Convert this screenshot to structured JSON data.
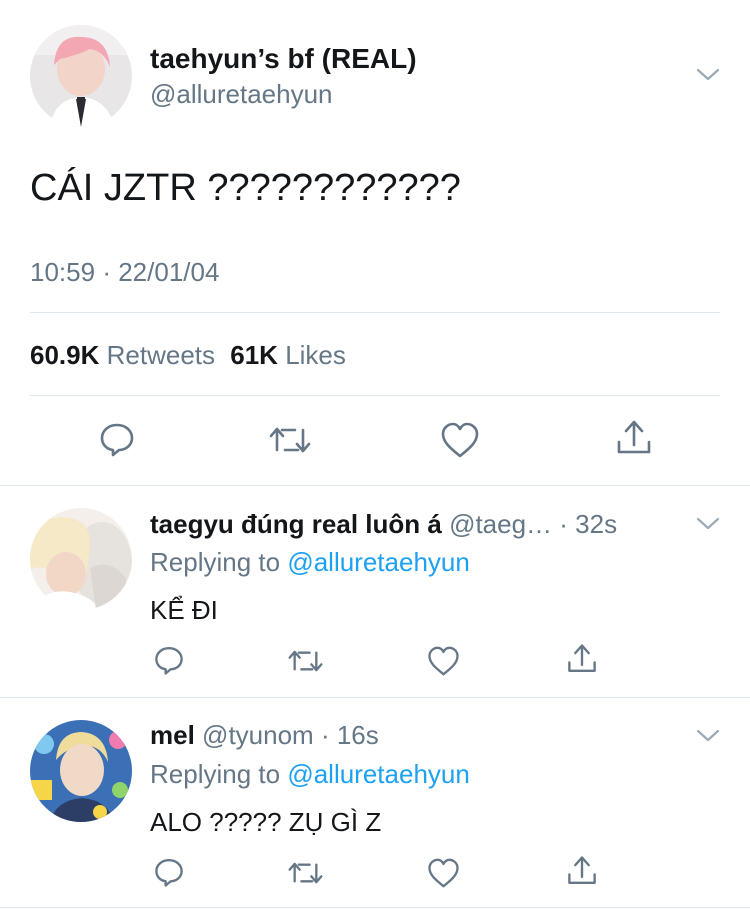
{
  "main_tweet": {
    "display_name": "taehyun’s bf (REAL)",
    "handle": "@alluretaehyun",
    "text": "CÁI JZTR ????????????",
    "time": "10:59",
    "sep": "·",
    "date": "22/01/04",
    "retweets_count": "60.9K",
    "retweets_label": "Retweets",
    "likes_count": "61K",
    "likes_label": "Likes"
  },
  "replies": [
    {
      "display_name": "taegyu đúng real luôn á",
      "handle": "@taeg…",
      "time": "· 32s",
      "replying_label": "Replying to",
      "replying_handle": "@alluretaehyun",
      "text": "KỂ ĐI"
    },
    {
      "display_name": "mel",
      "handle": "@tyunom",
      "time": "· 16s",
      "replying_label": "Replying to",
      "replying_handle": "@alluretaehyun",
      "text": "ALO ????? ZỤ GÌ Z"
    }
  ],
  "icons": [
    "chevron-down-icon",
    "reply-icon",
    "retweet-icon",
    "like-icon",
    "share-icon"
  ],
  "colors": {
    "text": "#14171a",
    "secondary": "#657786",
    "link": "#1da1f2",
    "icon": "#657786",
    "divider": "#e1e8ed"
  }
}
